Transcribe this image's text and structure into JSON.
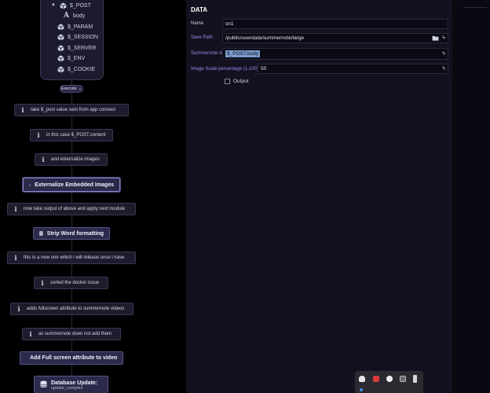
{
  "tree": {
    "items": [
      {
        "label": "$_POST",
        "icon": "cube-icon",
        "chevron": "▼"
      },
      {
        "label": "body",
        "icon": "text-a-icon"
      },
      {
        "label": "$_PARAM",
        "icon": "cube-icon"
      },
      {
        "label": "$_SESSION",
        "icon": "cube-icon"
      },
      {
        "label": "$_SERVER",
        "icon": "cube-icon"
      },
      {
        "label": "$_ENV",
        "icon": "cube-icon"
      },
      {
        "label": "$_COOKIE",
        "icon": "cube-icon"
      }
    ]
  },
  "execute": {
    "label": "Execute",
    "chevron": "⌄"
  },
  "nodes": [
    {
      "type": "info",
      "label": "take $_post  value sent from app  connect"
    },
    {
      "type": "info",
      "label": "in this case $_POST.content"
    },
    {
      "type": "info",
      "label": "and externalize images"
    },
    {
      "type": "action",
      "label": "Externalize Embedded Images",
      "icon": "image-icon"
    },
    {
      "type": "info",
      "label": "now take output of above and apply next module"
    },
    {
      "type": "action",
      "label": "Strip Word formatting",
      "icon": "document-icon"
    },
    {
      "type": "info",
      "label": "this is  a new one which i will release once i have"
    },
    {
      "type": "info",
      "label": "sorted the docker issue"
    },
    {
      "type": "info",
      "label": "adds fullscreen attribute to summernote videos"
    },
    {
      "type": "info",
      "label": "as summernote doen not add them"
    },
    {
      "type": "action",
      "label": "Add Full screen attribute to video",
      "icon": "monitor-icon"
    },
    {
      "type": "action",
      "label": "Database Update:",
      "sub": "update_complex",
      "icon": "database-icon"
    }
  ],
  "panel": {
    "title": "DATA",
    "name_label": "Name",
    "name_value": "sn1",
    "save_path_label": "Save Path",
    "save_path_value": "/public/userdata/summernote/large",
    "summernote_label": "Summernote data",
    "summernote_value": "$_POST.body",
    "scale_label": "Image Scale percentage (1-100)",
    "scale_value": "50",
    "output_label": "Output"
  },
  "colors": {
    "accent_label": "#9a8cf0",
    "panel_bg": "#13111f",
    "node_bg": "#1d1b2c",
    "action_bg": "#2c2a4a"
  }
}
